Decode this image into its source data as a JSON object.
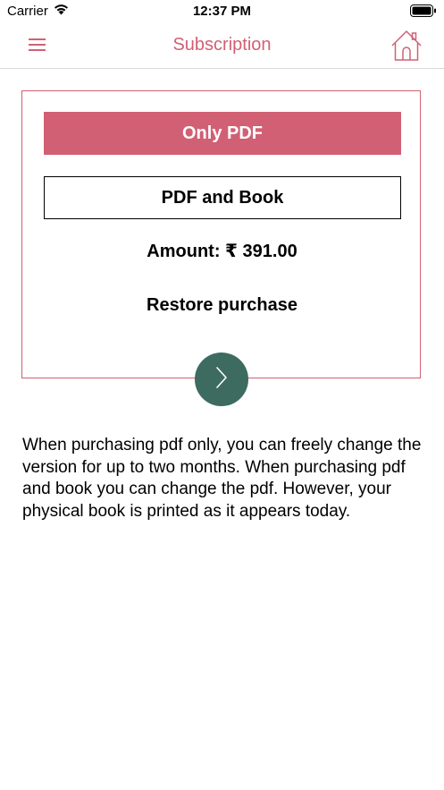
{
  "status_bar": {
    "carrier": "Carrier",
    "time": "12:37 PM"
  },
  "nav": {
    "title": "Subscription",
    "menu_icon": "hamburger-menu-icon",
    "home_icon": "home-icon"
  },
  "options": {
    "only_pdf": "Only PDF",
    "pdf_and_book": "PDF and Book",
    "selected": "Only PDF"
  },
  "amount": "Amount: ₹ 391.00",
  "restore": "Restore purchase",
  "next_icon": "chevron-right-icon",
  "info": "When purchasing pdf only, you can freely change the version for up to two months. When purchasing pdf and book you can change the pdf. However, your physical book is printed as it appears today.",
  "colors": {
    "accent": "#d16074",
    "next_button": "#3d6b60",
    "divider": "#d9d9d9"
  }
}
